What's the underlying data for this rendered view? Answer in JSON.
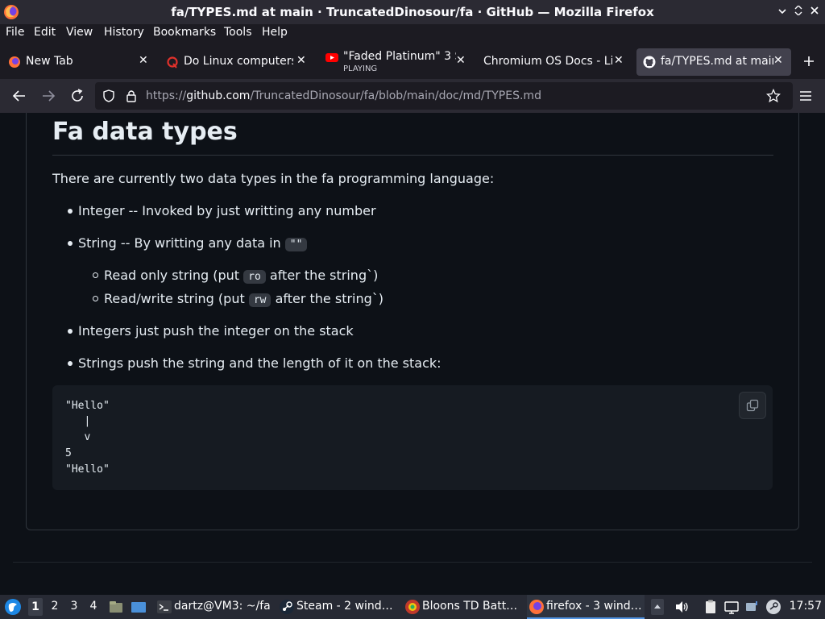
{
  "window": {
    "title": "fa/TYPES.md at main · TruncatedDinosour/fa · GitHub — Mozilla Firefox"
  },
  "menu": {
    "items": [
      {
        "label": "File"
      },
      {
        "label": "Edit"
      },
      {
        "label": "View"
      },
      {
        "label": "History"
      },
      {
        "label": "Bookmarks"
      },
      {
        "label": "Tools"
      },
      {
        "label": "Help"
      }
    ]
  },
  "tabs": [
    {
      "label": "New Tab",
      "icon": "firefox-icon"
    },
    {
      "label": "Do Linux computers ’",
      "icon": "quora-icon"
    },
    {
      "label": "\"Faded Platinum\" 3 S",
      "sub": "PLAYING",
      "icon": "youtube-icon"
    },
    {
      "label": "Chromium OS Docs - Lin",
      "icon": "none"
    },
    {
      "label": "fa/TYPES.md at main",
      "icon": "github-icon",
      "active": true
    }
  ],
  "navbar": {
    "url_prefix": "https://",
    "url_host": "github.com",
    "url_path": "/TruncatedDinosour/fa/blob/main/doc/md/TYPES.md"
  },
  "doc": {
    "heading": "Fa data types",
    "intro": "There are currently two data types in the fa programming language:",
    "bullet1": "Integer -- Invoked by just writting any number",
    "bullet2_text": "String -- By writting any data in",
    "bullet2_code": "\"\"",
    "sub1_pre": "Read only string (put",
    "sub1_code": "ro",
    "sub1_post": "after the string`)",
    "sub2_pre": "Read/write string (put",
    "sub2_code": "rw",
    "sub2_post": "after the string`)",
    "bullet3": "Integers just push the integer on the stack",
    "bullet4": "Strings push the string and the length of it on the stack:",
    "code_lines": [
      "\"Hello\"",
      "   |",
      "   v",
      "5",
      "\"Hello\""
    ]
  },
  "taskbar": {
    "workspaces": [
      "1",
      "2",
      "3",
      "4"
    ],
    "tasks": [
      {
        "label": "dartz@VM3: ~/fa",
        "icon": "terminal-icon"
      },
      {
        "label": "Steam - 2 wind…",
        "icon": "steam-icon"
      },
      {
        "label": "Bloons TD Batt…",
        "icon": "bloons-icon"
      },
      {
        "label": "firefox - 3 wind…",
        "icon": "firefox-icon",
        "active": true
      }
    ],
    "clock": "17:57"
  }
}
